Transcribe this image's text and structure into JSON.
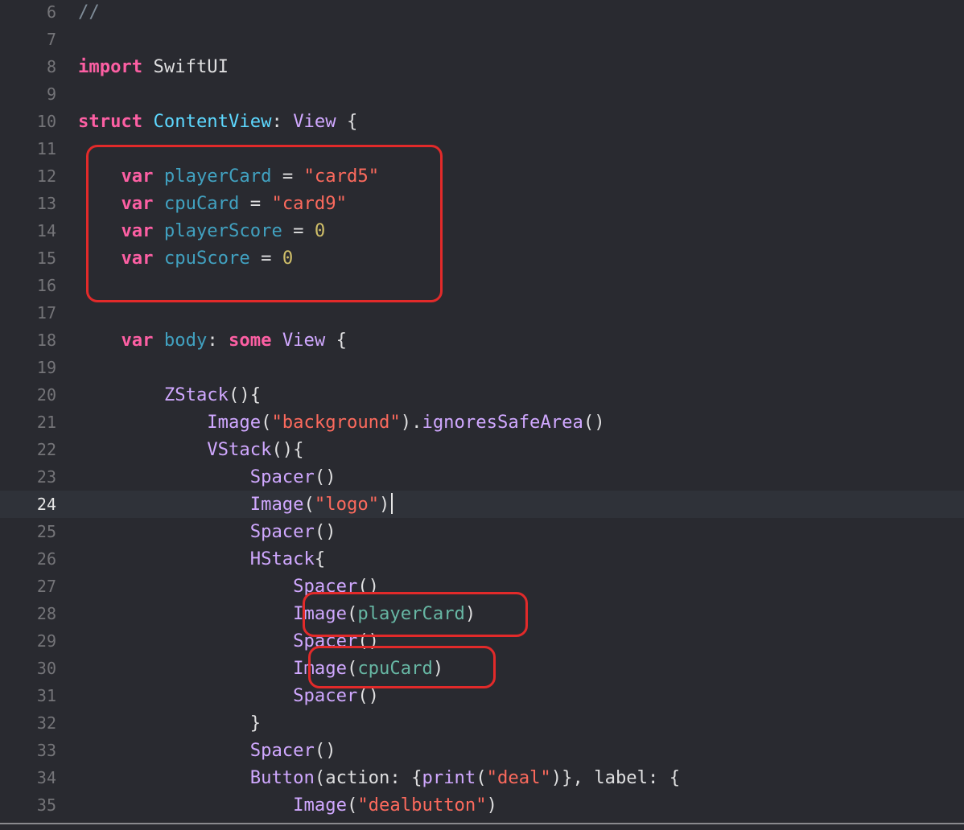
{
  "editor": {
    "current_line": 24,
    "lines": [
      {
        "num": "6",
        "tokens": [
          {
            "t": "//",
            "k": "comment"
          }
        ]
      },
      {
        "num": "7",
        "tokens": []
      },
      {
        "num": "8",
        "tokens": [
          {
            "t": "import",
            "k": "keyword"
          },
          {
            "t": " SwiftUI",
            "k": "plain"
          }
        ]
      },
      {
        "num": "9",
        "tokens": []
      },
      {
        "num": "10",
        "tokens": [
          {
            "t": "struct",
            "k": "keyword"
          },
          {
            "t": " ",
            "k": "plain"
          },
          {
            "t": "ContentView",
            "k": "type"
          },
          {
            "t": ": ",
            "k": "plain"
          },
          {
            "t": "View",
            "k": "std"
          },
          {
            "t": " {",
            "k": "plain"
          }
        ]
      },
      {
        "num": "11",
        "tokens": []
      },
      {
        "num": "12",
        "tokens": [
          {
            "t": "    ",
            "k": "plain"
          },
          {
            "t": "var",
            "k": "keyword"
          },
          {
            "t": " ",
            "k": "plain"
          },
          {
            "t": "playerCard",
            "k": "prop"
          },
          {
            "t": " = ",
            "k": "plain"
          },
          {
            "t": "\"card5\"",
            "k": "string"
          }
        ]
      },
      {
        "num": "13",
        "tokens": [
          {
            "t": "    ",
            "k": "plain"
          },
          {
            "t": "var",
            "k": "keyword"
          },
          {
            "t": " ",
            "k": "plain"
          },
          {
            "t": "cpuCard",
            "k": "prop"
          },
          {
            "t": " = ",
            "k": "plain"
          },
          {
            "t": "\"card9\"",
            "k": "string"
          }
        ]
      },
      {
        "num": "14",
        "tokens": [
          {
            "t": "    ",
            "k": "plain"
          },
          {
            "t": "var",
            "k": "keyword"
          },
          {
            "t": " ",
            "k": "plain"
          },
          {
            "t": "playerScore",
            "k": "prop"
          },
          {
            "t": " = ",
            "k": "plain"
          },
          {
            "t": "0",
            "k": "number"
          }
        ]
      },
      {
        "num": "15",
        "tokens": [
          {
            "t": "    ",
            "k": "plain"
          },
          {
            "t": "var",
            "k": "keyword"
          },
          {
            "t": " ",
            "k": "plain"
          },
          {
            "t": "cpuScore",
            "k": "prop"
          },
          {
            "t": " = ",
            "k": "plain"
          },
          {
            "t": "0",
            "k": "number"
          }
        ]
      },
      {
        "num": "16",
        "tokens": []
      },
      {
        "num": "17",
        "tokens": []
      },
      {
        "num": "18",
        "tokens": [
          {
            "t": "    ",
            "k": "plain"
          },
          {
            "t": "var",
            "k": "keyword"
          },
          {
            "t": " ",
            "k": "plain"
          },
          {
            "t": "body",
            "k": "prop"
          },
          {
            "t": ": ",
            "k": "plain"
          },
          {
            "t": "some",
            "k": "keyword"
          },
          {
            "t": " ",
            "k": "plain"
          },
          {
            "t": "View",
            "k": "std"
          },
          {
            "t": " {",
            "k": "plain"
          }
        ]
      },
      {
        "num": "19",
        "tokens": []
      },
      {
        "num": "20",
        "tokens": [
          {
            "t": "        ",
            "k": "plain"
          },
          {
            "t": "ZStack",
            "k": "std"
          },
          {
            "t": "(){",
            "k": "plain"
          }
        ]
      },
      {
        "num": "21",
        "tokens": [
          {
            "t": "            ",
            "k": "plain"
          },
          {
            "t": "Image",
            "k": "std"
          },
          {
            "t": "(",
            "k": "plain"
          },
          {
            "t": "\"background\"",
            "k": "string"
          },
          {
            "t": ").",
            "k": "plain"
          },
          {
            "t": "ignoresSafeArea",
            "k": "std"
          },
          {
            "t": "()",
            "k": "plain"
          }
        ]
      },
      {
        "num": "22",
        "tokens": [
          {
            "t": "            ",
            "k": "plain"
          },
          {
            "t": "VStack",
            "k": "std"
          },
          {
            "t": "(){",
            "k": "plain"
          }
        ]
      },
      {
        "num": "23",
        "tokens": [
          {
            "t": "                ",
            "k": "plain"
          },
          {
            "t": "Spacer",
            "k": "std"
          },
          {
            "t": "()",
            "k": "plain"
          }
        ]
      },
      {
        "num": "24",
        "tokens": [
          {
            "t": "                ",
            "k": "plain"
          },
          {
            "t": "Image",
            "k": "std"
          },
          {
            "t": "(",
            "k": "plain"
          },
          {
            "t": "\"logo\"",
            "k": "string"
          },
          {
            "t": ")",
            "k": "plain"
          }
        ],
        "cursor": true
      },
      {
        "num": "25",
        "tokens": [
          {
            "t": "                ",
            "k": "plain"
          },
          {
            "t": "Spacer",
            "k": "std"
          },
          {
            "t": "()",
            "k": "plain"
          }
        ]
      },
      {
        "num": "26",
        "tokens": [
          {
            "t": "                ",
            "k": "plain"
          },
          {
            "t": "HStack",
            "k": "std"
          },
          {
            "t": "{",
            "k": "plain"
          }
        ]
      },
      {
        "num": "27",
        "tokens": [
          {
            "t": "                    ",
            "k": "plain"
          },
          {
            "t": "Spacer",
            "k": "std"
          },
          {
            "t": "()",
            "k": "plain"
          }
        ]
      },
      {
        "num": "28",
        "tokens": [
          {
            "t": "                    ",
            "k": "plain"
          },
          {
            "t": "Image",
            "k": "std"
          },
          {
            "t": "(",
            "k": "plain"
          },
          {
            "t": "playerCard",
            "k": "local"
          },
          {
            "t": ")",
            "k": "plain"
          }
        ]
      },
      {
        "num": "29",
        "tokens": [
          {
            "t": "                    ",
            "k": "plain"
          },
          {
            "t": "Spacer",
            "k": "std"
          },
          {
            "t": "()",
            "k": "plain"
          }
        ]
      },
      {
        "num": "30",
        "tokens": [
          {
            "t": "                    ",
            "k": "plain"
          },
          {
            "t": "Image",
            "k": "std"
          },
          {
            "t": "(",
            "k": "plain"
          },
          {
            "t": "cpuCard",
            "k": "local"
          },
          {
            "t": ")",
            "k": "plain"
          }
        ]
      },
      {
        "num": "31",
        "tokens": [
          {
            "t": "                    ",
            "k": "plain"
          },
          {
            "t": "Spacer",
            "k": "std"
          },
          {
            "t": "()",
            "k": "plain"
          }
        ]
      },
      {
        "num": "32",
        "tokens": [
          {
            "t": "                ",
            "k": "plain"
          },
          {
            "t": "}",
            "k": "plain"
          }
        ]
      },
      {
        "num": "33",
        "tokens": [
          {
            "t": "                ",
            "k": "plain"
          },
          {
            "t": "Spacer",
            "k": "std"
          },
          {
            "t": "()",
            "k": "plain"
          }
        ]
      },
      {
        "num": "34",
        "tokens": [
          {
            "t": "                ",
            "k": "plain"
          },
          {
            "t": "Button",
            "k": "std"
          },
          {
            "t": "(action: {",
            "k": "plain"
          },
          {
            "t": "print",
            "k": "std"
          },
          {
            "t": "(",
            "k": "plain"
          },
          {
            "t": "\"deal\"",
            "k": "string"
          },
          {
            "t": ")}, label: {",
            "k": "plain"
          }
        ]
      },
      {
        "num": "35",
        "tokens": [
          {
            "t": "                    ",
            "k": "plain"
          },
          {
            "t": "Image",
            "k": "std"
          },
          {
            "t": "(",
            "k": "plain"
          },
          {
            "t": "\"dealbutton\"",
            "k": "string"
          },
          {
            "t": ")",
            "k": "plain"
          }
        ]
      }
    ]
  },
  "colors": {
    "background": "#292a30",
    "current_line": "#2f3239",
    "highlight_box": "#e22a2a"
  }
}
